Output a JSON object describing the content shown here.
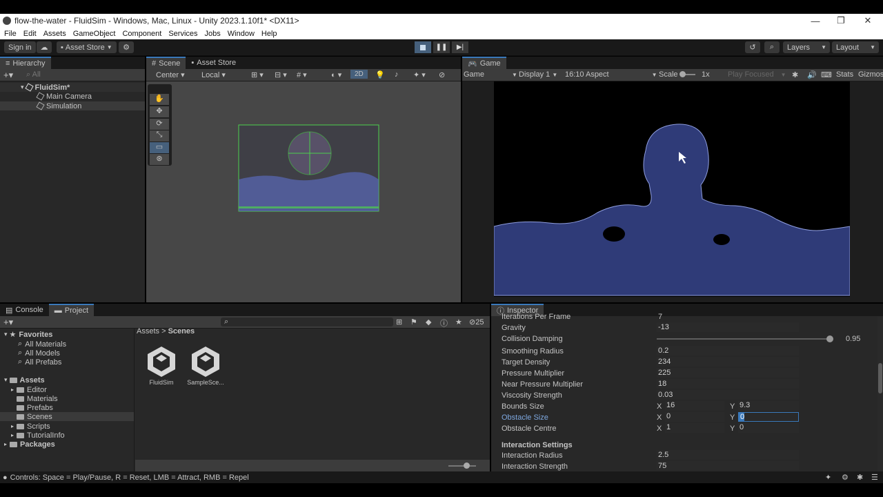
{
  "window": {
    "title": "flow-the-water - FluidSim - Windows, Mac, Linux - Unity 2023.1.10f1* <DX11>"
  },
  "menu": [
    "File",
    "Edit",
    "Assets",
    "GameObject",
    "Component",
    "Services",
    "Jobs",
    "Window",
    "Help"
  ],
  "toolbar": {
    "sign_in": "Sign in",
    "asset_store": "Asset Store",
    "layers": "Layers",
    "layout": "Layout"
  },
  "hierarchy": {
    "tab": "Hierarchy",
    "search_placeholder": "All",
    "scene": "FluidSim*",
    "items": [
      "Main Camera",
      "Simulation"
    ]
  },
  "scene_view": {
    "tabs": [
      "Scene",
      "Asset Store"
    ],
    "pivot": "Center",
    "space": "Local",
    "mode_2d": "2D"
  },
  "game_view": {
    "tab": "Game",
    "display_mode": "Game",
    "display": "Display 1",
    "aspect": "16:10 Aspect",
    "scale_label": "Scale",
    "scale_value": "1x",
    "play_focused": "Play Focused",
    "stats": "Stats",
    "gizmos": "Gizmos"
  },
  "bottom": {
    "tabs": [
      "Console",
      "Project"
    ],
    "hidden_count": "25",
    "favorites_label": "Favorites",
    "favorites": [
      "All Materials",
      "All Models",
      "All Prefabs"
    ],
    "assets_label": "Assets",
    "asset_folders": [
      "Editor",
      "Materials",
      "Prefabs",
      "Scenes",
      "Scripts",
      "TutorialInfo"
    ],
    "packages_label": "Packages",
    "breadcrumb_root": "Assets",
    "breadcrumb_sep": ">",
    "breadcrumb_current": "Scenes",
    "files": [
      "FluidSim",
      "SampleSce..."
    ]
  },
  "inspector": {
    "tab": "Inspector",
    "props": [
      {
        "label": "Iterations Per Frame",
        "value": "7"
      },
      {
        "label": "Gravity",
        "value": "-13"
      },
      {
        "label": "Collision Damping",
        "value": "0.95",
        "slider_fraction": 0.95
      },
      {
        "label": "Smoothing Radius",
        "value": "0.2"
      },
      {
        "label": "Target Density",
        "value": "234"
      },
      {
        "label": "Pressure Multiplier",
        "value": "225"
      },
      {
        "label": "Near Pressure Multiplier",
        "value": "18"
      },
      {
        "label": "Viscosity Strength",
        "value": "0.03"
      }
    ],
    "bounds": {
      "label": "Bounds Size",
      "x": "16",
      "y": "9.3"
    },
    "obstacle_size": {
      "label": "Obstacle Size",
      "x": "0",
      "y": "0"
    },
    "obstacle_centre": {
      "label": "Obstacle Centre",
      "x": "1",
      "y": "0"
    },
    "section": "Interaction Settings",
    "interaction": [
      {
        "label": "Interaction Radius",
        "value": "2.5"
      },
      {
        "label": "Interaction Strength",
        "value": "75"
      }
    ],
    "x_label": "X",
    "y_label": "Y"
  },
  "status": {
    "text": "Controls: Space = Play/Pause, R = Reset, LMB = Attract, RMB = Repel"
  },
  "colors": {
    "accent": "#3a79bb",
    "panel": "#282828",
    "header": "#3c3c3c",
    "fluid": "#5a6ab8",
    "gizmo": "#4dd04d"
  }
}
